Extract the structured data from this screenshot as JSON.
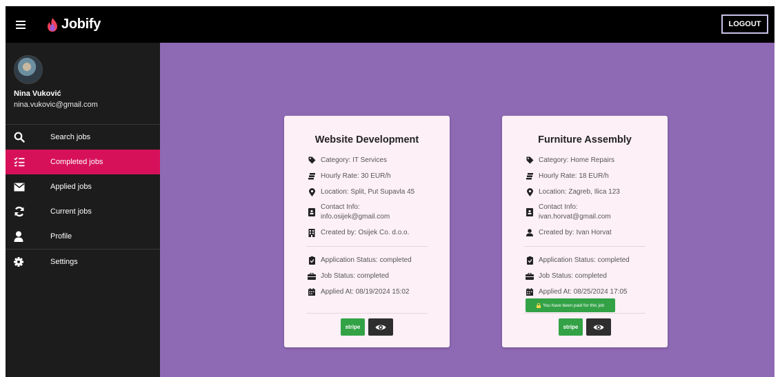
{
  "app": {
    "name": "Jobify",
    "logout_label": "LOGOUT"
  },
  "user": {
    "name": "Nina Vuković",
    "email": "nina.vukovic@gmail.com"
  },
  "sidebar": {
    "items": [
      {
        "label": "Search jobs",
        "icon": "search-icon"
      },
      {
        "label": "Completed jobs",
        "icon": "checklist-icon",
        "active": true
      },
      {
        "label": "Applied jobs",
        "icon": "envelope-icon"
      },
      {
        "label": "Current jobs",
        "icon": "refresh-icon"
      },
      {
        "label": "Profile",
        "icon": "user-icon"
      },
      {
        "label": "Settings",
        "icon": "gear-icon"
      }
    ]
  },
  "cards": [
    {
      "title": "Website Development",
      "category": "Category: IT Services",
      "hourly_rate": "Hourly Rate: 30 EUR/h",
      "location": "Location: Split, Put Supavla 45",
      "contact_label": "Contact Info:",
      "contact_value": "info.osijek@gmail.com",
      "created_by": "Created by: Osijek Co. d.o.o.",
      "application_status": "Application Status: completed",
      "job_status": "Job Status: completed",
      "applied_at": "Applied At: 08/19/2024 15:02",
      "stripe_label": "stripe"
    },
    {
      "title": "Furniture Assembly",
      "category": "Category: Home Repairs",
      "hourly_rate": "Hourly Rate: 18 EUR/h",
      "location": "Location: Zagreb, Ilica 123",
      "contact_label": "Contact Info:",
      "contact_value": "ivan.horvat@gmail.com",
      "created_by": "Created by: Ivan Horvat",
      "application_status": "Application Status: completed",
      "job_status": "Job Status: completed",
      "applied_at": "Applied At: 08/25/2024 17:05",
      "stripe_label": "stripe",
      "paid_toast": "You have been paid for this job"
    }
  ],
  "colors": {
    "accent": "#d6115a",
    "main_bg": "#8e69b4",
    "card_bg": "#fdf0f7",
    "stripe_green": "#33a246"
  }
}
